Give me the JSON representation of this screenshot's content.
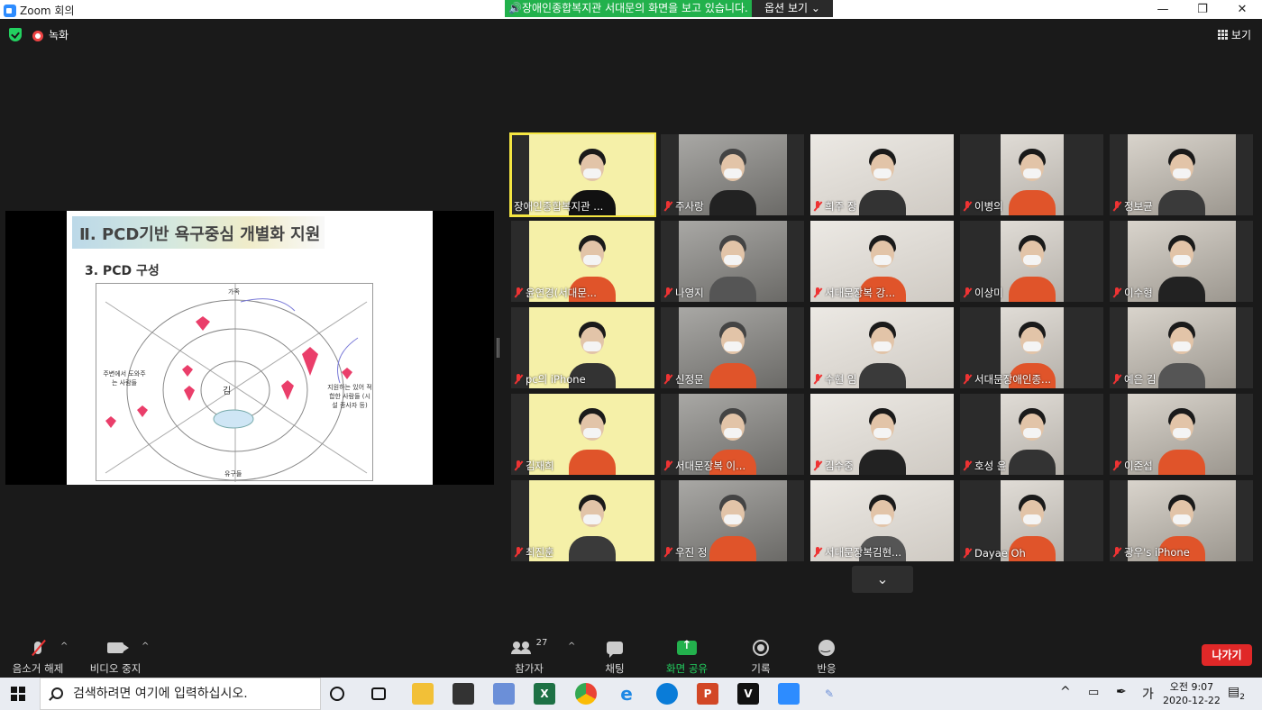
{
  "window": {
    "title": "Zoom 회의",
    "min": "—",
    "max": "❐",
    "close": "✕"
  },
  "share_banner": {
    "label": "장애인종합복지관 서대문의 화면을 보고 있습니다.",
    "options": "옵션 보기 ⌄"
  },
  "top": {
    "record_label": "녹화",
    "view_label": "보기"
  },
  "shared_slide": {
    "title": "Ⅱ. PCD기반 욕구중심 개별화 지원",
    "subtitle": "3. PCD 구성",
    "center": "김",
    "left_label": "주변에서 도와주는 사람들",
    "right_label": "지원하는 있어 적합한 사람들 (시설 종사자 등)",
    "top_label": "가족",
    "bottom_label": "유구들"
  },
  "participants": [
    {
      "name": "장애인종합복지관 ...",
      "muted": false,
      "active": true
    },
    {
      "name": "주사랑",
      "muted": true
    },
    {
      "name": "희주 장",
      "muted": true
    },
    {
      "name": "이병의",
      "muted": true
    },
    {
      "name": "정보균",
      "muted": true
    },
    {
      "name": "윤연경(서대문...",
      "muted": true
    },
    {
      "name": "나영지",
      "muted": true
    },
    {
      "name": "서대문장복 강...",
      "muted": true
    },
    {
      "name": "이상미",
      "muted": true
    },
    {
      "name": "이수형",
      "muted": true
    },
    {
      "name": "pc의 iPhone",
      "muted": true
    },
    {
      "name": "신정문",
      "muted": true
    },
    {
      "name": "수현 임",
      "muted": true
    },
    {
      "name": "서대문장애인종...",
      "muted": true
    },
    {
      "name": "예은 김",
      "muted": true
    },
    {
      "name": "김재희",
      "muted": true
    },
    {
      "name": "서대문장복 이...",
      "muted": true
    },
    {
      "name": "김수중",
      "muted": true
    },
    {
      "name": "호성 윤",
      "muted": true
    },
    {
      "name": "이준섭",
      "muted": true
    },
    {
      "name": "최진훈",
      "muted": true
    },
    {
      "name": "우진 정",
      "muted": true
    },
    {
      "name": "서대문장복김현...",
      "muted": true
    },
    {
      "name": "Dayae Oh",
      "muted": true
    },
    {
      "name": "광우's iPhone",
      "muted": true
    }
  ],
  "pager_icon": "⌄",
  "toolbar": {
    "unmute": "음소거 해제",
    "video": "비디오 중지",
    "participants": "참가자",
    "participants_count": "27",
    "chat": "채팅",
    "share": "화면 공유",
    "record": "기록",
    "reactions": "반응",
    "leave": "나가기",
    "caret": "^"
  },
  "taskbar": {
    "search_placeholder": "검색하려면 여기에 입력하십시오.",
    "ime": "가",
    "ampm_time": "오전 9:07",
    "date": "2020-12-22",
    "notify_count": "2"
  }
}
